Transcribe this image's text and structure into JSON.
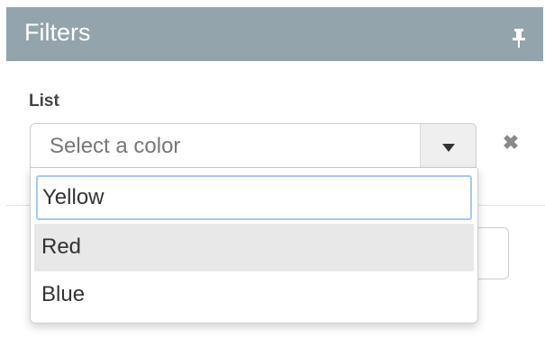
{
  "header": {
    "title": "Filters",
    "pin_icon": "pin-icon"
  },
  "filter": {
    "label": "List",
    "select_placeholder": "Select a color",
    "clear_icon": "close-icon",
    "clear_glyph": "✖"
  },
  "dropdown": {
    "search_value": "Yellow",
    "options": [
      {
        "label": "Red",
        "highlighted": true
      },
      {
        "label": "Blue",
        "highlighted": false
      }
    ]
  },
  "colors": {
    "header_bg": "#93a4ad",
    "focus_border": "#a6c8ef",
    "highlight_bg": "#e8e8e8"
  }
}
